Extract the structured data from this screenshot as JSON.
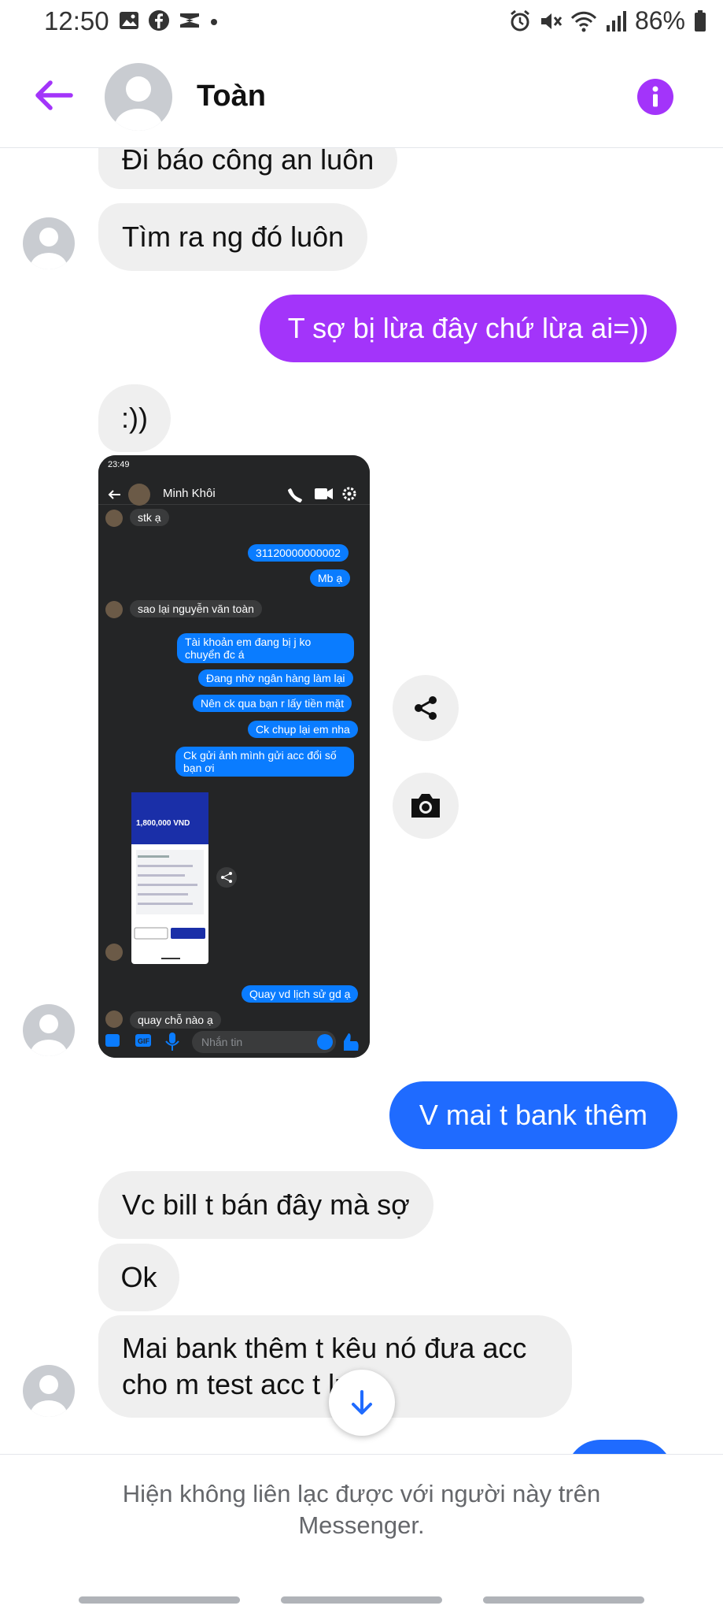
{
  "status_bar": {
    "time": "12:50",
    "battery": "86%"
  },
  "header": {
    "contact_name": "Toàn"
  },
  "messages": [
    {
      "side": "in",
      "text": "Đi báo công an luôn"
    },
    {
      "side": "in",
      "text": "Tìm ra ng đó luôn"
    },
    {
      "side": "out",
      "text": "T sợ bị lừa đây chứ lừa ai=))"
    },
    {
      "side": "in",
      "text": ":))"
    },
    {
      "side": "out",
      "text": "V mai t bank thêm"
    },
    {
      "side": "in",
      "text": "Vc bill t bán đây mà sợ"
    },
    {
      "side": "in",
      "text": "Ok"
    },
    {
      "side": "in",
      "text": "Mai bank thêm t kêu nó đưa acc\ncho m test acc ",
      "text_after": "t luôn"
    }
  ],
  "screenshot": {
    "time": "23:49",
    "contact_name": "Minh Khôi",
    "messages": [
      {
        "side": "in",
        "text": "stk ạ"
      },
      {
        "side": "out",
        "text": "31120000000002"
      },
      {
        "side": "out",
        "text": "Mb ạ"
      },
      {
        "side": "in",
        "text": "sao lại nguyễn văn toàn"
      },
      {
        "side": "out",
        "text": "Tài khoản em đang bị j ko\nchuyển đc á"
      },
      {
        "side": "out",
        "text": "Đang nhờ ngân hàng làm lại"
      },
      {
        "side": "out",
        "text": "Nên ck qua bạn r lấy tiền mặt"
      },
      {
        "side": "out",
        "text": "Ck chụp lại em nha"
      },
      {
        "side": "out",
        "text": "Ck gửi ảnh mình gửi acc đổi số\nbạn ơi"
      },
      {
        "side": "out",
        "text": "Quay vd lịch sử gd ạ"
      },
      {
        "side": "in",
        "text": "quay chỗ nào ạ"
      }
    ],
    "receipt_amount": "1,800,000 VND",
    "input_placeholder": "Nhắn tin"
  },
  "footer": {
    "notice": "Hiện không liên lạc được với người này trên\nMessenger."
  },
  "colors": {
    "accent_purple": "#a334fa",
    "bubble_blue": "#1f6bff",
    "incoming_gray": "#efefef"
  }
}
